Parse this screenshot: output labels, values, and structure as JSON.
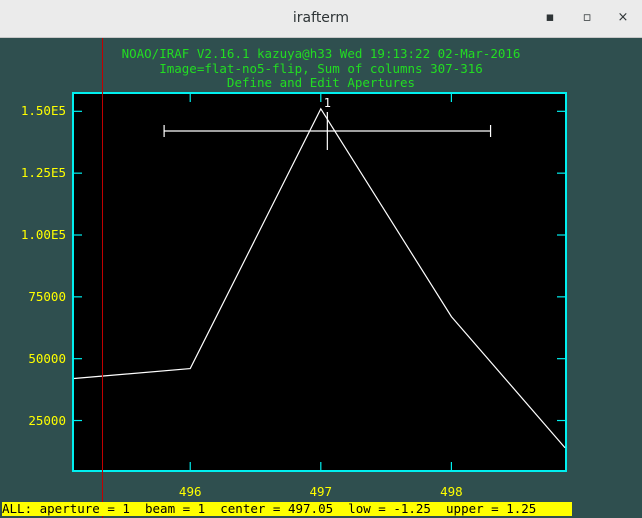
{
  "window": {
    "title": "irafterm",
    "minimize_glyph": "▪",
    "maximize_glyph": "▫",
    "close_glyph": "×"
  },
  "header": {
    "line1": "NOAO/IRAF V2.16.1 kazuya@h33 Wed 19:13:22 02-Mar-2016",
    "line2": "Image=flat-no5-flip, Sum of columns 307-316",
    "line3": "Define and Edit Apertures"
  },
  "status_bar": {
    "text": "ALL: aperture = 1  beam = 1  center = 497.05  low = -1.25  upper = 1.25"
  },
  "colors": {
    "terminal_bg": "#2f4f4f",
    "plot_border": "#00f0f0",
    "header_text": "#22dd22",
    "axis_text": "#ffff00",
    "cursor_line": "#c00000"
  },
  "chart_data": {
    "type": "line",
    "title": "Define and Edit Apertures",
    "xlabel": "",
    "ylabel": "",
    "xlim": [
      495.11,
      498.87
    ],
    "ylim": [
      5000,
      157000
    ],
    "x_ticks": [
      496,
      497,
      498
    ],
    "x_tick_labels": [
      "496",
      "497",
      "498"
    ],
    "y_ticks": [
      25000,
      50000,
      75000,
      100000,
      125000,
      150000
    ],
    "y_tick_labels": [
      "25000",
      "50000",
      "75000",
      "1.00E5",
      "1.25E5",
      "1.50E5"
    ],
    "series": [
      {
        "x": [
          495.11,
          496.0,
          497.0,
          498.0,
          498.87
        ],
        "y": [
          42000,
          46000,
          151000,
          67000,
          14000
        ]
      }
    ],
    "aperture": {
      "label": "1",
      "center": 497.05,
      "low": -1.25,
      "upper": 1.25
    }
  }
}
